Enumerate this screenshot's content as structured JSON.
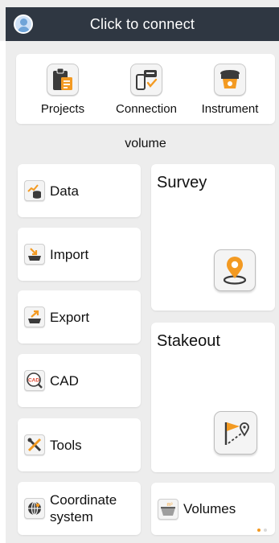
{
  "topbar": {
    "title": "Click to connect",
    "avatar_icon": "user-avatar-icon"
  },
  "quickbar": {
    "items": [
      {
        "label": "Projects",
        "icon": "clipboard-icon"
      },
      {
        "label": "Connection",
        "icon": "device-connection-icon"
      },
      {
        "label": "Instrument",
        "icon": "gnss-receiver-icon"
      }
    ]
  },
  "section_title": "volume",
  "left_items": [
    {
      "label": "Data",
      "icon": "data-chart-icon"
    },
    {
      "label": "Import",
      "icon": "import-tray-icon"
    },
    {
      "label": "Export",
      "icon": "export-tray-icon"
    },
    {
      "label": "CAD",
      "icon": "cad-icon",
      "icon_text": "CAD"
    },
    {
      "label": "Tools",
      "icon": "tools-icon"
    },
    {
      "label": "Coordinate system",
      "icon": "globe-grid-icon"
    }
  ],
  "survey": {
    "label": "Survey",
    "icon": "location-pin-icon"
  },
  "stakeout": {
    "label": "Stakeout",
    "icon": "flag-stakeout-icon"
  },
  "volumes": {
    "label": "Volumes",
    "icon": "volume-basin-icon",
    "icon_text": "m³"
  },
  "pager": {
    "pages": 2,
    "active": 1
  },
  "colors": {
    "topbar": "#2f3742",
    "accent": "#f39a22",
    "background": "#ededed",
    "card": "#ffffff"
  }
}
